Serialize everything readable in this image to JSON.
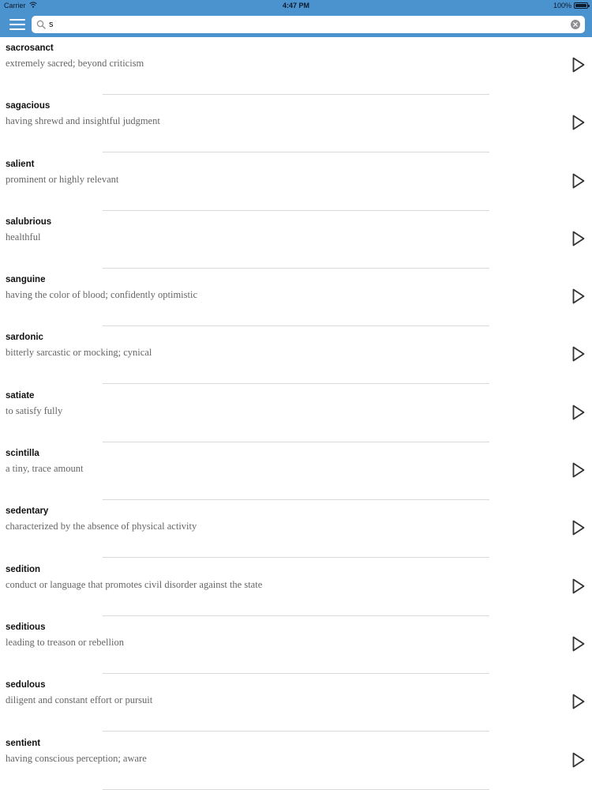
{
  "status_bar": {
    "carrier": "Carrier",
    "time": "4:47 PM",
    "battery": "100%",
    "battery_level": 1.0
  },
  "nav": {
    "menu_icon": "hamburger-menu-icon",
    "search": {
      "value": "s",
      "placeholder": "",
      "search_icon": "magnifier-icon",
      "clear_icon": "clear-circle-x-icon"
    }
  },
  "colors": {
    "nav_background": "#4a93cf",
    "word_text": "#111111",
    "definition_text": "#666666",
    "divider": "#d9d9d9"
  },
  "words": [
    {
      "word": "sacrosanct",
      "definition": "extremely sacred; beyond criticism"
    },
    {
      "word": "sagacious",
      "definition": "having shrewd and insightful judgment"
    },
    {
      "word": "salient",
      "definition": "prominent or highly relevant"
    },
    {
      "word": "salubrious",
      "definition": "healthful"
    },
    {
      "word": "sanguine",
      "definition": "having the color of blood; confidently optimistic"
    },
    {
      "word": "sardonic",
      "definition": "bitterly sarcastic or mocking; cynical"
    },
    {
      "word": "satiate",
      "definition": "to satisfy fully"
    },
    {
      "word": "scintilla",
      "definition": "a tiny, trace amount"
    },
    {
      "word": "sedentary",
      "definition": "characterized by the absence of physical activity"
    },
    {
      "word": "sedition",
      "definition": "conduct or language that promotes civil disorder against the state"
    },
    {
      "word": "seditious",
      "definition": "leading to treason or rebellion"
    },
    {
      "word": "sedulous",
      "definition": "diligent and constant effort or pursuit"
    },
    {
      "word": "sentient",
      "definition": "having conscious perception; aware"
    }
  ],
  "row_action_icon": "play-triangle-icon"
}
